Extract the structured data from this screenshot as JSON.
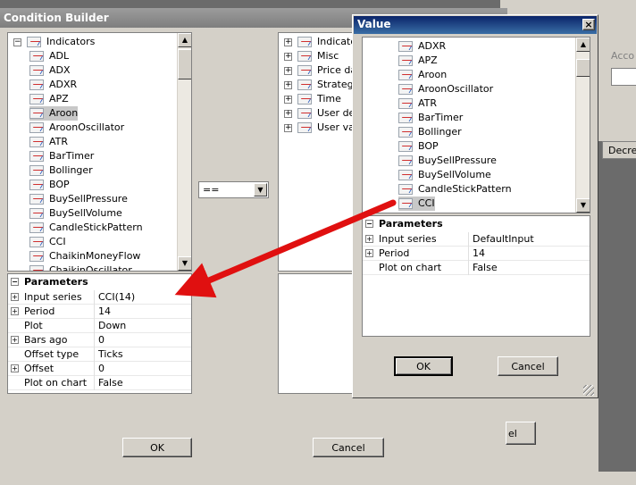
{
  "condition_builder": {
    "title": "Condition Builder",
    "indicators": {
      "root_label": "Indicators",
      "items": [
        "ADL",
        "ADX",
        "ADXR",
        "APZ",
        "Aroon",
        "AroonOscillator",
        "ATR",
        "BarTimer",
        "Bollinger",
        "BOP",
        "BuySellPressure",
        "BuySellVolume",
        "CandleStickPattern",
        "CCI",
        "ChaikinMoneyFlow",
        "ChaikinOscillator"
      ],
      "selected": "Aroon"
    },
    "parameters": {
      "header": "Parameters",
      "rows": [
        {
          "name": "Input series",
          "value": "CCI(14)",
          "expandable": true
        },
        {
          "name": "Period",
          "value": "14",
          "expandable": true
        },
        {
          "name": "Plot",
          "value": "Down",
          "expandable": false
        },
        {
          "name": "Bars ago",
          "value": "0",
          "expandable": true
        },
        {
          "name": "Offset type",
          "value": "Ticks",
          "expandable": false
        },
        {
          "name": "Offset",
          "value": "0",
          "expandable": true
        },
        {
          "name": "Plot on chart",
          "value": "False",
          "expandable": false
        }
      ]
    },
    "operator": "==",
    "right_tree": [
      "Indicato",
      "Misc",
      "Price da",
      "Strategy",
      "Time",
      "User de",
      "User va"
    ],
    "ok_label": "OK",
    "cancel_label": "Cancel",
    "side_label": "Acco",
    "column_label": "Decre",
    "back_button_label": "el"
  },
  "value_dialog": {
    "title": "Value",
    "close": "×",
    "items": [
      "ADXR",
      "APZ",
      "Aroon",
      "AroonOscillator",
      "ATR",
      "BarTimer",
      "Bollinger",
      "BOP",
      "BuySellPressure",
      "BuySellVolume",
      "CandleStickPattern",
      "CCI"
    ],
    "selected": "CCI",
    "parameters": {
      "header": "Parameters",
      "rows": [
        {
          "name": "Input series",
          "value": "DefaultInput",
          "expandable": true
        },
        {
          "name": "Period",
          "value": "14",
          "expandable": true
        },
        {
          "name": "Plot on chart",
          "value": "False",
          "expandable": false
        }
      ]
    },
    "ok_label": "OK",
    "cancel_label": "Cancel"
  },
  "colors": {
    "arrow": "#e01010",
    "title_active": "#0a246a",
    "dialog_bg": "#d4d0c8"
  }
}
